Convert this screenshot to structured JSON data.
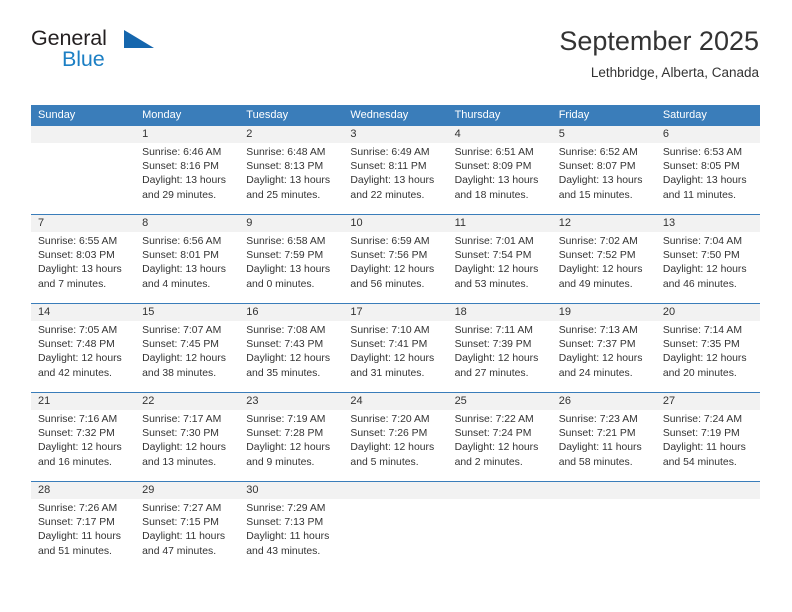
{
  "brand": {
    "name_top": "General",
    "name_bottom": "Blue",
    "accent_color": "#1c7fc4",
    "triangle_color": "#1566ad"
  },
  "header": {
    "title": "September 2025",
    "subtitle": "Lethbridge, Alberta, Canada"
  },
  "calendar": {
    "header_bg": "#3a7dba",
    "date_band_bg": "#f2f2f2",
    "weekdays": [
      "Sunday",
      "Monday",
      "Tuesday",
      "Wednesday",
      "Thursday",
      "Friday",
      "Saturday"
    ],
    "weeks": [
      [
        {
          "day": "",
          "lines": []
        },
        {
          "day": "1",
          "lines": [
            "Sunrise: 6:46 AM",
            "Sunset: 8:16 PM",
            "Daylight: 13 hours",
            "and 29 minutes."
          ]
        },
        {
          "day": "2",
          "lines": [
            "Sunrise: 6:48 AM",
            "Sunset: 8:13 PM",
            "Daylight: 13 hours",
            "and 25 minutes."
          ]
        },
        {
          "day": "3",
          "lines": [
            "Sunrise: 6:49 AM",
            "Sunset: 8:11 PM",
            "Daylight: 13 hours",
            "and 22 minutes."
          ]
        },
        {
          "day": "4",
          "lines": [
            "Sunrise: 6:51 AM",
            "Sunset: 8:09 PM",
            "Daylight: 13 hours",
            "and 18 minutes."
          ]
        },
        {
          "day": "5",
          "lines": [
            "Sunrise: 6:52 AM",
            "Sunset: 8:07 PM",
            "Daylight: 13 hours",
            "and 15 minutes."
          ]
        },
        {
          "day": "6",
          "lines": [
            "Sunrise: 6:53 AM",
            "Sunset: 8:05 PM",
            "Daylight: 13 hours",
            "and 11 minutes."
          ]
        }
      ],
      [
        {
          "day": "7",
          "lines": [
            "Sunrise: 6:55 AM",
            "Sunset: 8:03 PM",
            "Daylight: 13 hours",
            "and 7 minutes."
          ]
        },
        {
          "day": "8",
          "lines": [
            "Sunrise: 6:56 AM",
            "Sunset: 8:01 PM",
            "Daylight: 13 hours",
            "and 4 minutes."
          ]
        },
        {
          "day": "9",
          "lines": [
            "Sunrise: 6:58 AM",
            "Sunset: 7:59 PM",
            "Daylight: 13 hours",
            "and 0 minutes."
          ]
        },
        {
          "day": "10",
          "lines": [
            "Sunrise: 6:59 AM",
            "Sunset: 7:56 PM",
            "Daylight: 12 hours",
            "and 56 minutes."
          ]
        },
        {
          "day": "11",
          "lines": [
            "Sunrise: 7:01 AM",
            "Sunset: 7:54 PM",
            "Daylight: 12 hours",
            "and 53 minutes."
          ]
        },
        {
          "day": "12",
          "lines": [
            "Sunrise: 7:02 AM",
            "Sunset: 7:52 PM",
            "Daylight: 12 hours",
            "and 49 minutes."
          ]
        },
        {
          "day": "13",
          "lines": [
            "Sunrise: 7:04 AM",
            "Sunset: 7:50 PM",
            "Daylight: 12 hours",
            "and 46 minutes."
          ]
        }
      ],
      [
        {
          "day": "14",
          "lines": [
            "Sunrise: 7:05 AM",
            "Sunset: 7:48 PM",
            "Daylight: 12 hours",
            "and 42 minutes."
          ]
        },
        {
          "day": "15",
          "lines": [
            "Sunrise: 7:07 AM",
            "Sunset: 7:45 PM",
            "Daylight: 12 hours",
            "and 38 minutes."
          ]
        },
        {
          "day": "16",
          "lines": [
            "Sunrise: 7:08 AM",
            "Sunset: 7:43 PM",
            "Daylight: 12 hours",
            "and 35 minutes."
          ]
        },
        {
          "day": "17",
          "lines": [
            "Sunrise: 7:10 AM",
            "Sunset: 7:41 PM",
            "Daylight: 12 hours",
            "and 31 minutes."
          ]
        },
        {
          "day": "18",
          "lines": [
            "Sunrise: 7:11 AM",
            "Sunset: 7:39 PM",
            "Daylight: 12 hours",
            "and 27 minutes."
          ]
        },
        {
          "day": "19",
          "lines": [
            "Sunrise: 7:13 AM",
            "Sunset: 7:37 PM",
            "Daylight: 12 hours",
            "and 24 minutes."
          ]
        },
        {
          "day": "20",
          "lines": [
            "Sunrise: 7:14 AM",
            "Sunset: 7:35 PM",
            "Daylight: 12 hours",
            "and 20 minutes."
          ]
        }
      ],
      [
        {
          "day": "21",
          "lines": [
            "Sunrise: 7:16 AM",
            "Sunset: 7:32 PM",
            "Daylight: 12 hours",
            "and 16 minutes."
          ]
        },
        {
          "day": "22",
          "lines": [
            "Sunrise: 7:17 AM",
            "Sunset: 7:30 PM",
            "Daylight: 12 hours",
            "and 13 minutes."
          ]
        },
        {
          "day": "23",
          "lines": [
            "Sunrise: 7:19 AM",
            "Sunset: 7:28 PM",
            "Daylight: 12 hours",
            "and 9 minutes."
          ]
        },
        {
          "day": "24",
          "lines": [
            "Sunrise: 7:20 AM",
            "Sunset: 7:26 PM",
            "Daylight: 12 hours",
            "and 5 minutes."
          ]
        },
        {
          "day": "25",
          "lines": [
            "Sunrise: 7:22 AM",
            "Sunset: 7:24 PM",
            "Daylight: 12 hours",
            "and 2 minutes."
          ]
        },
        {
          "day": "26",
          "lines": [
            "Sunrise: 7:23 AM",
            "Sunset: 7:21 PM",
            "Daylight: 11 hours",
            "and 58 minutes."
          ]
        },
        {
          "day": "27",
          "lines": [
            "Sunrise: 7:24 AM",
            "Sunset: 7:19 PM",
            "Daylight: 11 hours",
            "and 54 minutes."
          ]
        }
      ],
      [
        {
          "day": "28",
          "lines": [
            "Sunrise: 7:26 AM",
            "Sunset: 7:17 PM",
            "Daylight: 11 hours",
            "and 51 minutes."
          ]
        },
        {
          "day": "29",
          "lines": [
            "Sunrise: 7:27 AM",
            "Sunset: 7:15 PM",
            "Daylight: 11 hours",
            "and 47 minutes."
          ]
        },
        {
          "day": "30",
          "lines": [
            "Sunrise: 7:29 AM",
            "Sunset: 7:13 PM",
            "Daylight: 11 hours",
            "and 43 minutes."
          ]
        },
        {
          "day": "",
          "lines": []
        },
        {
          "day": "",
          "lines": []
        },
        {
          "day": "",
          "lines": []
        },
        {
          "day": "",
          "lines": []
        }
      ]
    ]
  }
}
